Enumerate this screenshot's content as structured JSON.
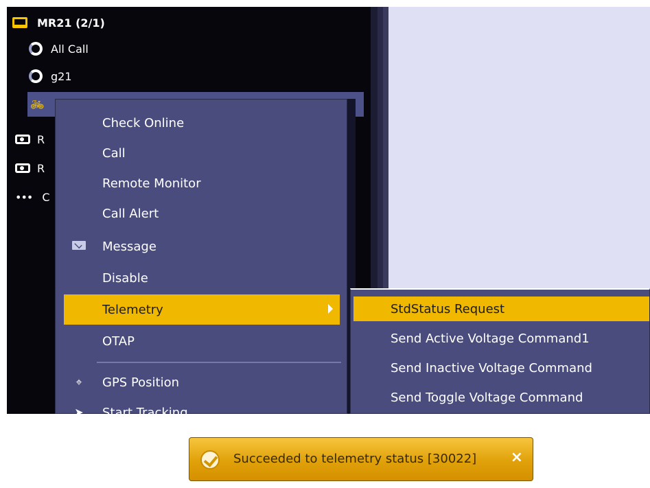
{
  "tree": {
    "device": "MR21 (2/1)",
    "items": [
      {
        "label": "All Call",
        "icon": "talkgroup-icon"
      },
      {
        "label": "g21",
        "icon": "talkgroup-icon"
      }
    ],
    "selected_icon": "bicycle-icon",
    "partial_rows": [
      {
        "label": "R",
        "icon": "radio-icon"
      },
      {
        "label": "R",
        "icon": "radio-icon"
      },
      {
        "label": "C",
        "icon": "more-dots-icon"
      }
    ]
  },
  "context_menu": {
    "items": [
      {
        "label": "Check Online"
      },
      {
        "label": "Call"
      },
      {
        "label": "Remote Monitor"
      },
      {
        "label": "Call Alert"
      },
      {
        "label": "Message",
        "icon": "envelope-icon"
      },
      {
        "label": "Disable"
      },
      {
        "label": "Telemetry",
        "active": true,
        "has_submenu": true
      },
      {
        "label": "OTAP"
      },
      {
        "label": "GPS Position",
        "icon": "crosshair-icon"
      },
      {
        "label": "Start Tracking",
        "icon": "arrow-icon"
      }
    ]
  },
  "telemetry_submenu": {
    "items": [
      {
        "label": "StdStatus Request",
        "active": true
      },
      {
        "label": "Send Active Voltage Command1"
      },
      {
        "label": "Send Inactive Voltage Command"
      },
      {
        "label": "Send Toggle Voltage Command"
      }
    ]
  },
  "toast": {
    "message": "Succeeded to telemetry status [30022]",
    "close_glyph": "×",
    "icon": "check-circle-icon"
  },
  "colors": {
    "menu_bg": "#494c7d",
    "highlight": "#f1b800",
    "selected_row": "#4d5189",
    "accent_yellow": "#f6c400"
  }
}
